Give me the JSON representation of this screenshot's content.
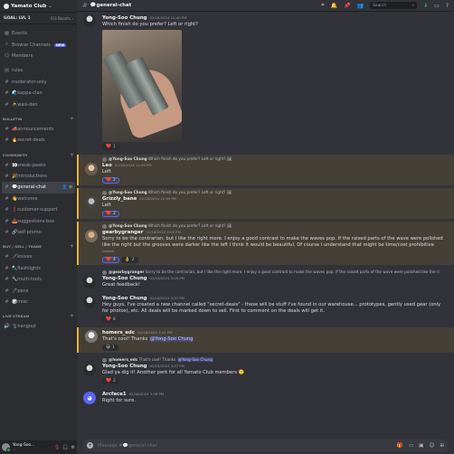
{
  "server": {
    "name": "Yamato Club",
    "goal_label": "GOAL: LVL 1",
    "goal_progress": "0/3 Boosts"
  },
  "top_items": [
    {
      "name": "events",
      "label": "Events",
      "glyph": "▦"
    },
    {
      "name": "browse-channels",
      "label": "Browse Channels",
      "glyph": "⌕",
      "badge": "NEW"
    },
    {
      "name": "members",
      "label": "Members",
      "glyph": "☺"
    }
  ],
  "channels_top": [
    {
      "label": "rules"
    },
    {
      "label": "moderator-only"
    },
    {
      "label": "🌊kappa-clan"
    },
    {
      "label": "🥷wasi-den"
    }
  ],
  "categories": {
    "bulletin": "BULLETIN",
    "community": "COMMUNITY",
    "buy_sell_trade": "BUY / SELL / TRADE",
    "live_stream": "LIVE STREAM"
  },
  "channels_bulletin": [
    {
      "label": "📣announcements"
    },
    {
      "label": "🔥secret-deals"
    }
  ],
  "channels_community": [
    {
      "label": "👀sneak-peeks"
    },
    {
      "label": "🎉introductions"
    },
    {
      "label": "💬general-chat"
    },
    {
      "label": "👋welcome"
    },
    {
      "label": "❗customer-support"
    },
    {
      "label": "📥suggestions-box"
    },
    {
      "label": "🔗self-promo"
    }
  ],
  "channels_bst": [
    {
      "label": "🗡knives"
    },
    {
      "label": "🔦flashlights"
    },
    {
      "label": "🔧multi-tools"
    },
    {
      "label": "🖊pens"
    },
    {
      "label": "🎲misc"
    }
  ],
  "channels_live": [
    {
      "label": "🎙hangout"
    }
  ],
  "user": {
    "name": "Yong-Soo...",
    "status": "..."
  },
  "topbar": {
    "channel": "💬general-chat",
    "search_placeholder": "Search"
  },
  "messages": [
    {
      "author": "Yong-Soo Chung",
      "time": "02/18/2024 12:40 PM",
      "text": "Which finish do you prefer? Left or right?",
      "reacts": [
        {
          "emoji": "❤️",
          "count": "1"
        }
      ]
    },
    {
      "reply_author": "@Yong-Soo Chung",
      "reply_text": "Which finish do you prefer? Left or right?",
      "author": "Leo",
      "time": "02/18/2024 12:56 PM",
      "text": "Left",
      "reacts": [
        {
          "emoji": "❤️",
          "count": "2"
        }
      ]
    },
    {
      "reply_author": "@Yong-Soo Chung",
      "reply_text": "Which finish do you prefer? Left or right?",
      "author": "Grizzly_bane",
      "time": "02/18/2024 12:59 PM",
      "text": "Left",
      "reacts": [
        {
          "emoji": "❤️",
          "count": "2"
        }
      ]
    },
    {
      "reply_author": "@Yong-Soo Chung",
      "reply_text": "Which finish do you prefer? Left or right?",
      "author": "gearbygranger",
      "time": "02/18/2024 2:05 PM",
      "text": "Sorry to be the contrarian, but I like the right more. I enjoy a good contrast to make the waves pop. If the raised parts of the wave were polished like the right but the grooves were darker like the left I think it would be beautiful. Of course I understand that might be time/cost prohibitive",
      "edited": "(edited)",
      "reacts": [
        {
          "emoji": "❤️",
          "count": "4"
        },
        {
          "emoji": "👌",
          "count": "2"
        }
      ]
    },
    {
      "reply_author": "@gearbygranger",
      "reply_text": "Sorry to be the contrarian, but I like the right more. I enjoy a good contrast to make the waves pop. If the raised parts of the wave were polished like the ri",
      "author": "Yong-Soo Chung",
      "time": "02/18/2024 3:09 PM",
      "text": "Great feedback!"
    },
    {
      "author": "Yong-Soo Chung",
      "time": "02/18/2024 3:37 PM",
      "text": "Hey guys, I've created a new channel called \"secret-deals\" - these will be stuff I've found in our warehouse... prototypes, gently used gear (only for photos), etc.  All deals will be marked down to sell.  First to comment on the deals will get it.",
      "reacts": [
        {
          "emoji": "❤️",
          "count": "8"
        }
      ]
    },
    {
      "author": "homers_edc",
      "time": "02/18/2024 3:41 PM",
      "text": "That's cool! Thanks ",
      "mention": "@Yong-Soo Chung",
      "reacts": [
        {
          "emoji": "😀",
          "count": "1"
        }
      ]
    },
    {
      "reply_author": "@homers_edc",
      "reply_text": "That's cool! Thanks ",
      "reply_mention": "@Yong-Soo Chung",
      "author": "Yong-Soo Chung",
      "time": "02/18/2024 3:47 PM",
      "text": "Glad ya dig it!  Another perk for all Yamato Club members 🙂",
      "reacts": [
        {
          "emoji": "❤️",
          "count": "2"
        }
      ]
    },
    {
      "author": "Arcface1",
      "time": "02/18/2024 3:58 PM",
      "text": "Right for sure."
    }
  ],
  "composer": {
    "placeholder": "Message #💬general-chat"
  }
}
